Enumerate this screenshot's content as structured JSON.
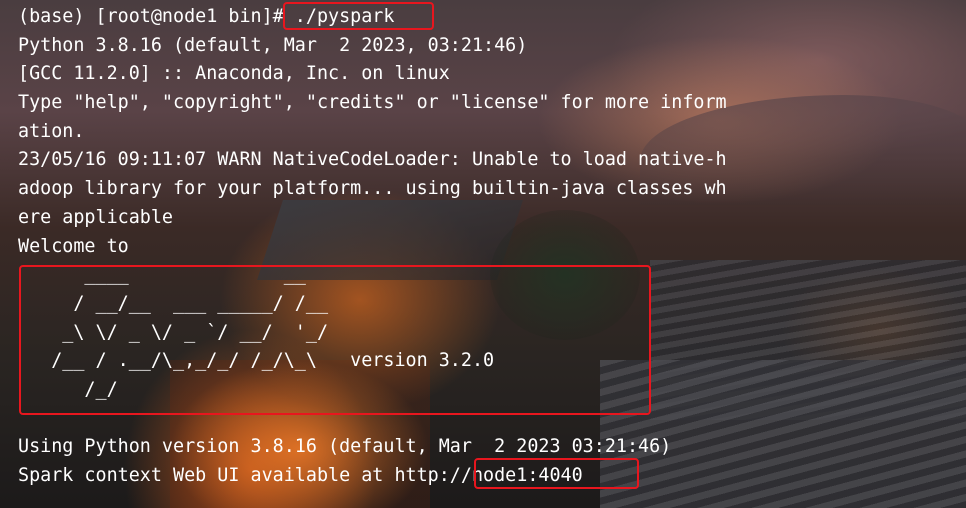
{
  "terminal": {
    "lines": [
      "(base) [root@node1 bin]# ./pyspark",
      "Python 3.8.16 (default, Mar  2 2023, 03:21:46)",
      "[GCC 11.2.0] :: Anaconda, Inc. on linux",
      "Type \"help\", \"copyright\", \"credits\" or \"license\" for more inform",
      "ation.",
      "23/05/16 09:11:07 WARN NativeCodeLoader: Unable to load native-h",
      "adoop library for your platform... using builtin-java classes wh",
      "ere applicable",
      "Welcome to",
      "      ____              __",
      "     / __/__  ___ _____/ /__",
      "    _\\ \\/ _ \\/ _ `/ __/  '_/",
      "   /__ / .__/\\_,_/_/ /_/\\_\\   version 3.2.0",
      "      /_/",
      "",
      "Using Python version 3.8.16 (default, Mar  2 2023 03:21:46)",
      "Spark context Web UI available at http://node1:4040"
    ]
  },
  "highlights": {
    "color": "#e8161e",
    "items": [
      "pyspark command",
      "Spark ASCII banner",
      "node1:4040 address"
    ]
  }
}
